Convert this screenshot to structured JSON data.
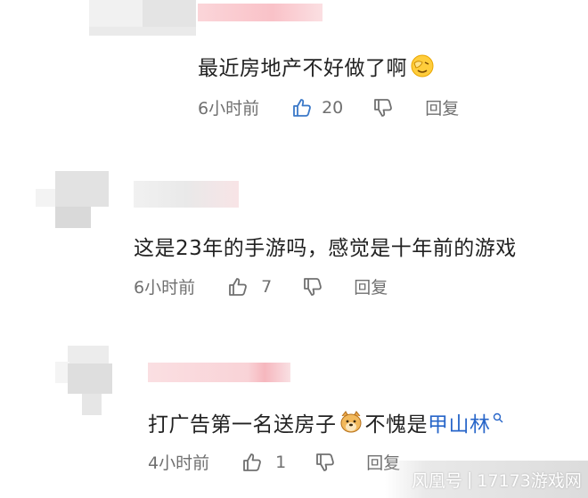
{
  "comments": [
    {
      "text": "最近房地产不好做了啊",
      "time": "6小时前",
      "likes": "20",
      "reply_label": "回复",
      "emoji": "facepalm-emoji"
    },
    {
      "text": "这是23年的手游吗，感觉是十年前的游戏",
      "time": "6小时前",
      "likes": "7",
      "reply_label": "回复"
    },
    {
      "text_before": "打广告第一名送房子",
      "text_after": "不愧是",
      "mention": "甲山林",
      "time": "4小时前",
      "likes": "1",
      "reply_label": "回复",
      "emoji": "doge-emoji"
    }
  ],
  "watermark": {
    "logo_text": "风凰号",
    "separator": "|",
    "site": "17173游戏网"
  },
  "colors": {
    "text": "#222222",
    "meta": "#707070",
    "mention": "#2866c9",
    "like_icon": "#3a78c8"
  }
}
